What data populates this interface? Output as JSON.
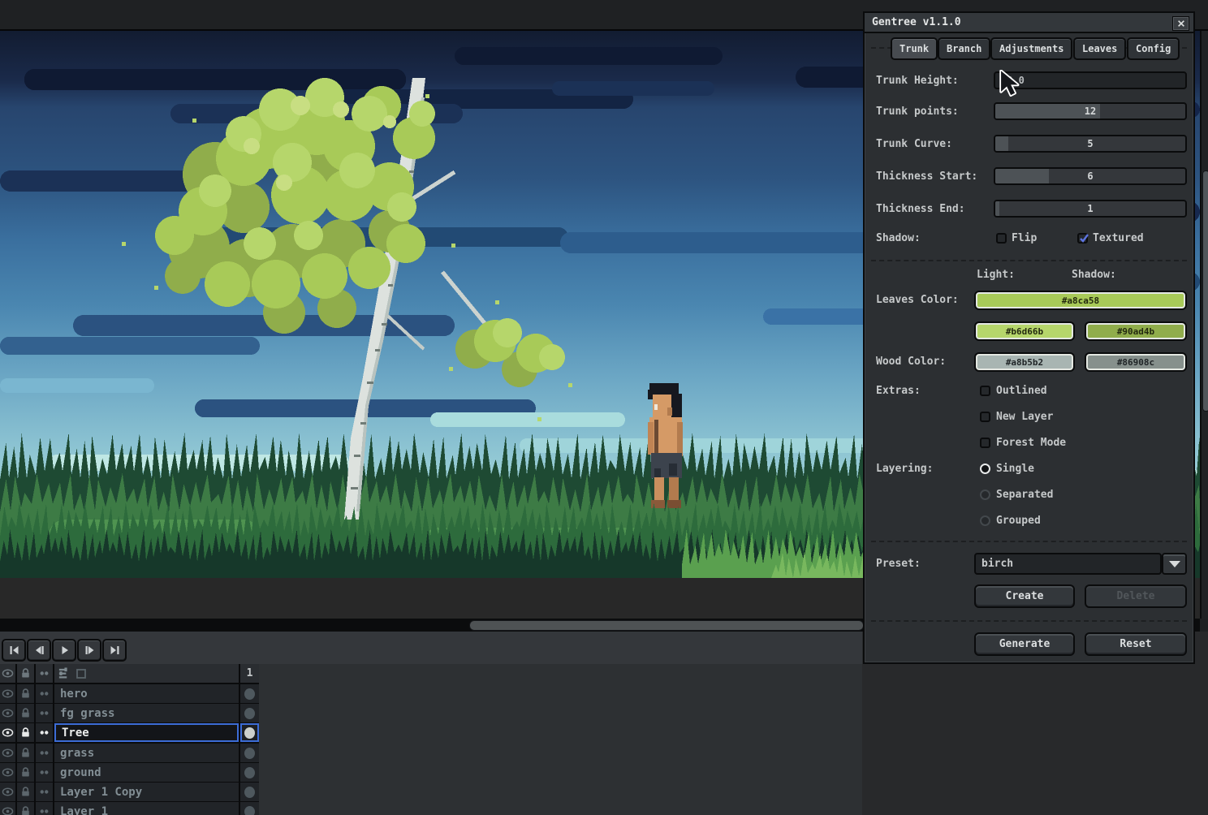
{
  "window": {
    "title": "Gentree v1.1.0"
  },
  "tabs": [
    {
      "label": "Trunk",
      "active": true
    },
    {
      "label": "Branch",
      "active": false
    },
    {
      "label": "Adjustments",
      "active": false
    },
    {
      "label": "Leaves",
      "active": false
    },
    {
      "label": "Config",
      "active": false
    }
  ],
  "trunk": {
    "height": {
      "label": "Trunk Height:",
      "value": "80.0"
    },
    "points": {
      "label": "Trunk points:",
      "value": "12",
      "fill_pct": 55
    },
    "curve": {
      "label": "Trunk Curve:",
      "value": "5",
      "fill_pct": 7
    },
    "thickness_start": {
      "label": "Thickness Start:",
      "value": "6",
      "fill_pct": 28
    },
    "thickness_end": {
      "label": "Thickness End:",
      "value": "1",
      "fill_pct": 2
    },
    "shadow_label": "Shadow:",
    "flip": {
      "label": "Flip",
      "checked": false
    },
    "textured": {
      "label": "Textured",
      "checked": true
    }
  },
  "colors": {
    "light_header": "Light:",
    "shadow_header": "Shadow:",
    "leaves_label": "Leaves Color:",
    "leaves_main": "#a8ca58",
    "leaves_light": "#b6d66b",
    "leaves_shadow": "#90ad4b",
    "wood_label": "Wood Color:",
    "wood_light": "#a8b5b2",
    "wood_shadow": "#86908c"
  },
  "extras": {
    "label": "Extras:",
    "options": [
      {
        "label": "Outlined",
        "checked": false
      },
      {
        "label": "New Layer",
        "checked": false
      },
      {
        "label": "Forest Mode",
        "checked": false
      }
    ]
  },
  "layering": {
    "label": "Layering:",
    "options": [
      {
        "label": "Single",
        "selected": true
      },
      {
        "label": "Separated",
        "selected": false
      },
      {
        "label": "Grouped",
        "selected": false
      }
    ]
  },
  "preset": {
    "label": "Preset:",
    "value": "birch",
    "create": "Create",
    "delete": "Delete"
  },
  "actions": {
    "generate": "Generate",
    "reset": "Reset"
  },
  "timeline": {
    "frame_number": "1",
    "selected_layer": "Tree",
    "layers": [
      {
        "name": "hero"
      },
      {
        "name": "fg grass"
      },
      {
        "name": "Tree"
      },
      {
        "name": "grass"
      },
      {
        "name": "ground"
      },
      {
        "name": "Layer 1 Copy"
      },
      {
        "name": "Layer 1"
      }
    ]
  }
}
